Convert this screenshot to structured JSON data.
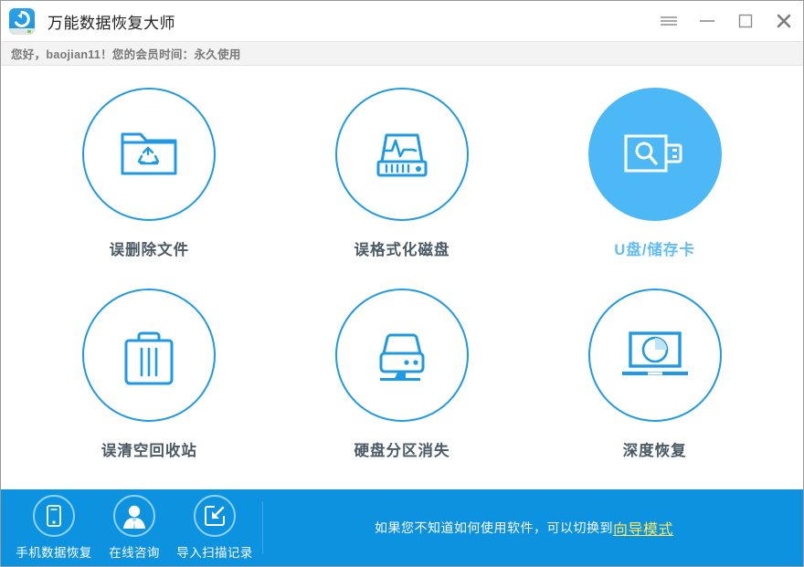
{
  "window": {
    "title": "万能数据恢复大师",
    "logo_icon": "recovery-logo-icon",
    "controls": [
      {
        "name": "menu-button",
        "icon": "hamburger-menu-icon"
      },
      {
        "name": "minimize-button",
        "icon": "minimize-icon"
      },
      {
        "name": "maximize-button",
        "icon": "maximize-icon"
      },
      {
        "name": "close-button",
        "icon": "close-icon"
      }
    ]
  },
  "greeting": {
    "text": "您好，baojian11！您的会员时间：永久使用"
  },
  "modes": [
    {
      "id": "deleted-files",
      "label": "误删除文件",
      "icon": "folder-recycle-icon",
      "selected": false
    },
    {
      "id": "formatted-disk",
      "label": "误格式化磁盘",
      "icon": "disk-pulse-icon",
      "selected": false
    },
    {
      "id": "usb-memory-card",
      "label": "U盘/储存卡",
      "icon": "usb-search-icon",
      "selected": true
    },
    {
      "id": "emptied-recycle-bin",
      "label": "误清空回收站",
      "icon": "trash-can-icon",
      "selected": false
    },
    {
      "id": "lost-partition",
      "label": "硬盘分区消失",
      "icon": "hard-disk-stand-icon",
      "selected": false
    },
    {
      "id": "deep-recovery",
      "label": "深度恢复",
      "icon": "laptop-pie-icon",
      "selected": false
    }
  ],
  "bottom_bar": {
    "quick_actions": [
      {
        "id": "phone-recovery",
        "label": "手机数据恢复",
        "icon": "mobile-phone-icon"
      },
      {
        "id": "online-consult",
        "label": "在线咨询",
        "icon": "person-avatar-icon"
      },
      {
        "id": "import-scan-record",
        "label": "导入扫描记录",
        "icon": "import-arrow-icon"
      }
    ],
    "hint_prefix": "如果您不知道如何使用软件，可以切换到 ",
    "hint_link": "向导模式"
  },
  "colors": {
    "accent_blue": "#1e9ae4",
    "selected_blue": "#4cb8f5",
    "bottom_bar_blue": "#0d92e0",
    "link_yellow": "#ffe85c",
    "label_gray": "#4a5a66"
  }
}
